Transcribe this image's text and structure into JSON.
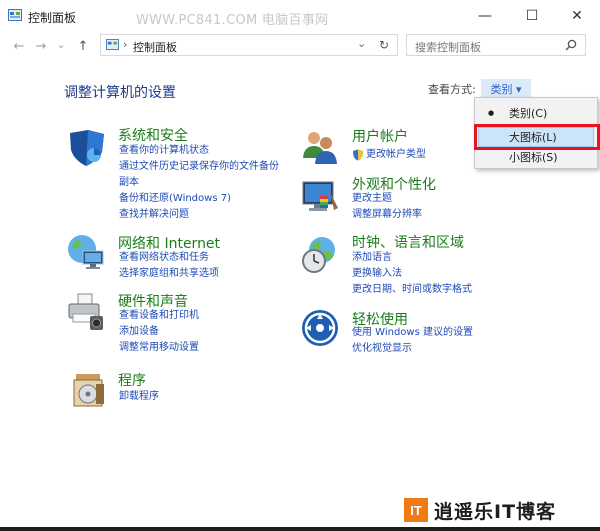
{
  "window": {
    "title": "控制面板",
    "watermark": "WWW.PC841.COM 电脑百事网",
    "minimize_glyph": "—",
    "maximize_glyph": "☐",
    "close_glyph": "✕"
  },
  "nav": {
    "back_glyph": "←",
    "forward_glyph": "→",
    "recent_glyph": "⌄",
    "up_glyph": "↑",
    "breadcrumb_sep": "›",
    "breadcrumb": "控制面板",
    "dropdown_glyph": "⌄",
    "refresh_glyph": "↻",
    "search_placeholder": "搜索控制面板"
  },
  "main": {
    "title": "调整计算机的设置",
    "view_by_label": "查看方式:",
    "view_by_value": "类别 ▾"
  },
  "categories_left": [
    {
      "icon": "shield-icon",
      "title": "系统和安全",
      "links": [
        "查看你的计算机状态",
        "通过文件历史记录保存你的文件备份",
        "副本",
        "备份和还原(Windows 7)",
        "查找并解决问题"
      ]
    },
    {
      "icon": "network-icon",
      "title": "网络和 Internet",
      "links": [
        "查看网络状态和任务",
        "选择家庭组和共享选项"
      ]
    },
    {
      "icon": "printer-icon",
      "title": "硬件和声音",
      "links": [
        "查看设备和打印机",
        "添加设备",
        "调整常用移动设置"
      ]
    },
    {
      "icon": "programs-icon",
      "title": "程序",
      "links": [
        "卸载程序"
      ]
    }
  ],
  "categories_right": [
    {
      "icon": "users-icon",
      "title": "用户帐户",
      "links": [
        "更改帐户类型"
      ]
    },
    {
      "icon": "appearance-icon",
      "title": "外观和个性化",
      "links": [
        "更改主题",
        "调整屏幕分辨率"
      ]
    },
    {
      "icon": "clock-globe-icon",
      "title": "时钟、语言和区域",
      "links": [
        "添加语言",
        "更换输入法",
        "更改日期、时间或数字格式"
      ]
    },
    {
      "icon": "ease-of-access-icon",
      "title": "轻松使用",
      "links": [
        "使用 Windows 建议的设置",
        "优化视觉显示"
      ]
    }
  ],
  "dropdown": {
    "items": [
      {
        "label": "类别(C)",
        "selected": true
      },
      {
        "label": "大图标(L)",
        "highlighted": true
      },
      {
        "label": "小图标(S)"
      }
    ],
    "bullet": "●"
  },
  "logo": {
    "text": "逍遥乐IT博客",
    "mark": "IT"
  },
  "colors": {
    "accent": "#2b63c5",
    "category_title": "#1a7d1a",
    "link": "#1f4bb5",
    "highlight_box": "#e8131c",
    "logo_orange": "#f07b16"
  }
}
